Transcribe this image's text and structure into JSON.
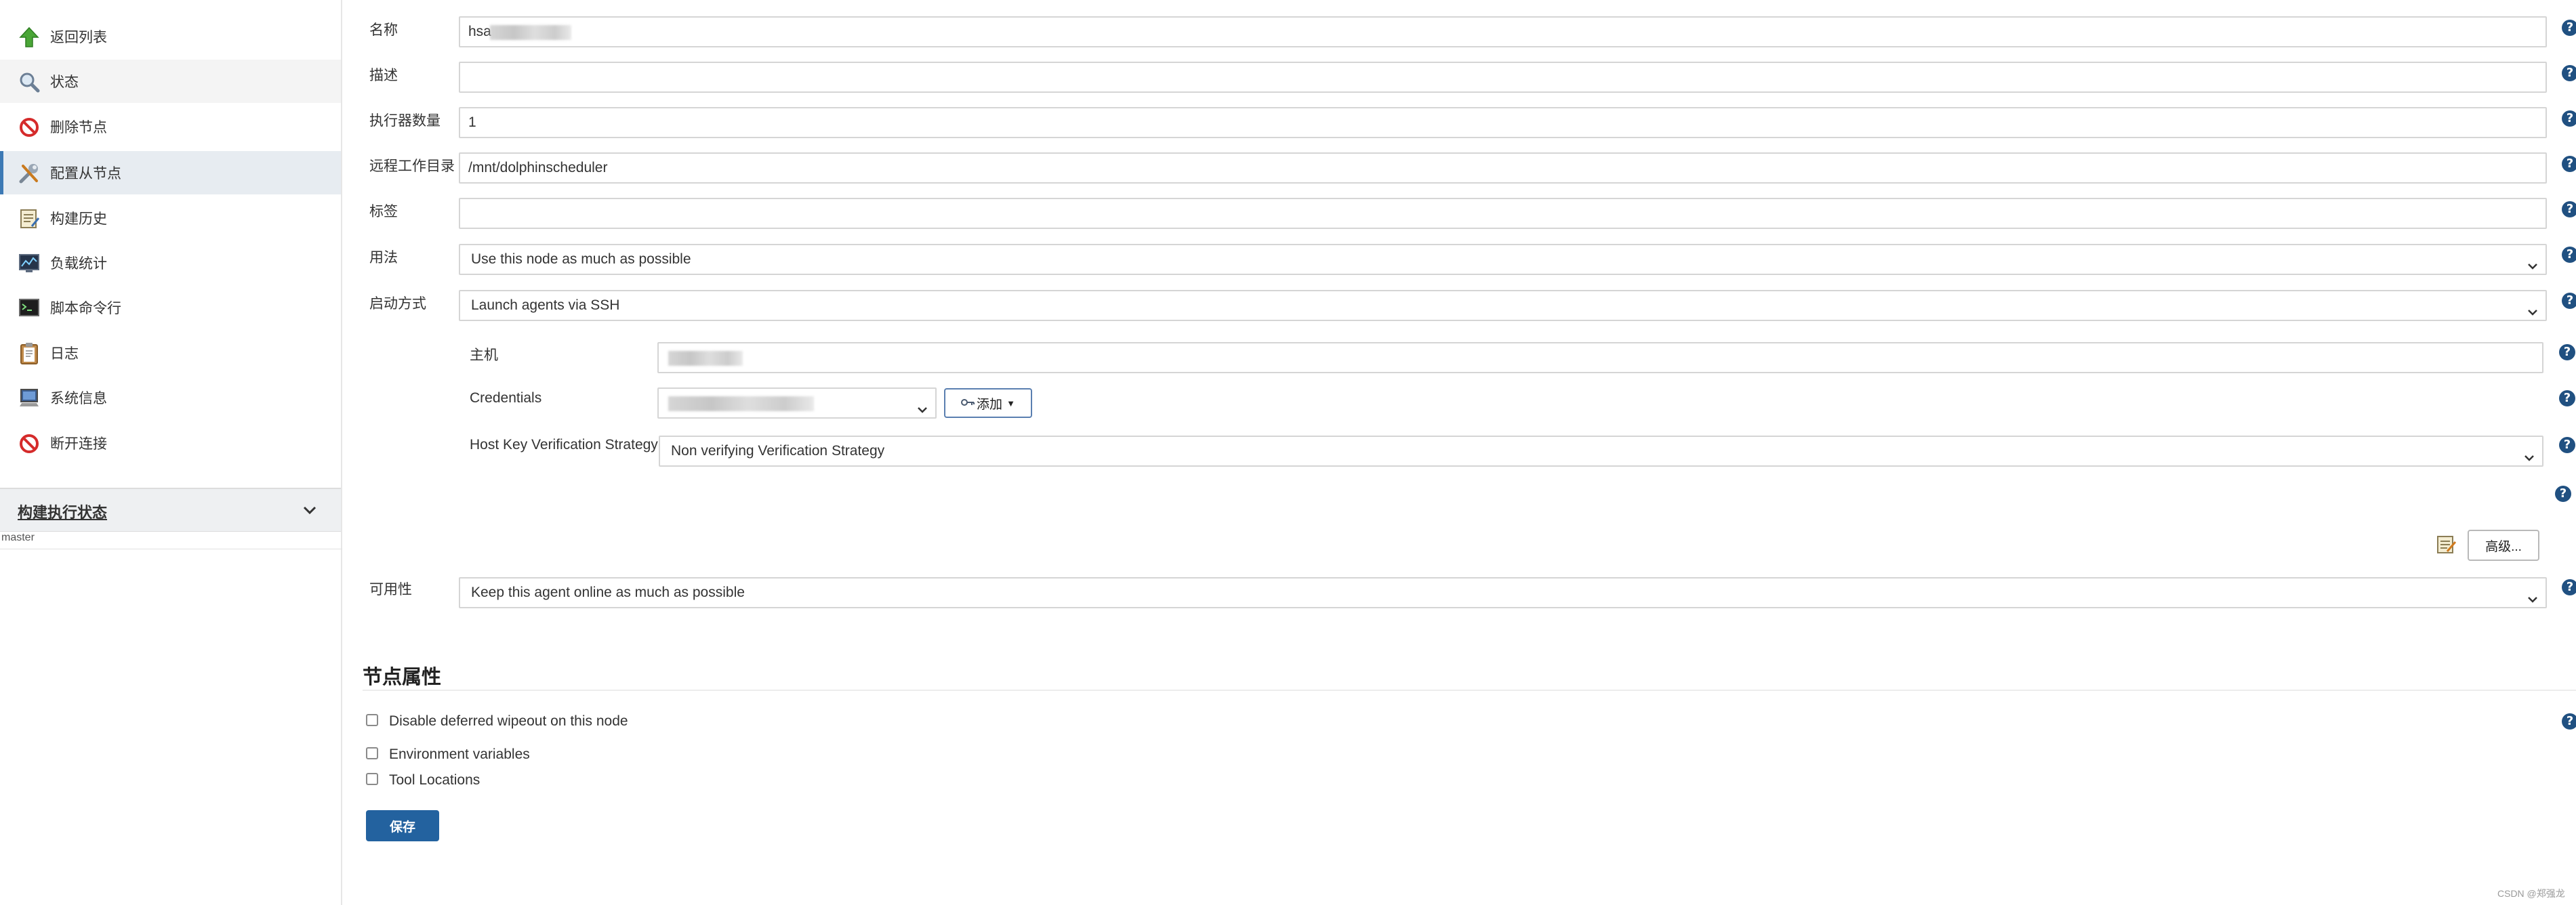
{
  "sidebar": {
    "items": [
      {
        "label": "返回列表",
        "icon": "up-arrow-icon"
      },
      {
        "label": "状态",
        "icon": "magnifier-icon"
      },
      {
        "label": "删除节点",
        "icon": "no-entry-icon"
      },
      {
        "label": "配置从节点",
        "icon": "tools-icon"
      },
      {
        "label": "构建历史",
        "icon": "notepad-icon"
      },
      {
        "label": "负载统计",
        "icon": "monitor-chart-icon"
      },
      {
        "label": "脚本命令行",
        "icon": "terminal-icon"
      },
      {
        "label": "日志",
        "icon": "clipboard-icon"
      },
      {
        "label": "系统信息",
        "icon": "computer-icon"
      },
      {
        "label": "断开连接",
        "icon": "no-entry-icon"
      }
    ],
    "executor_status": {
      "title": "构建执行状态",
      "node": "master"
    }
  },
  "form": {
    "name": {
      "label": "名称",
      "value": "hsa"
    },
    "description": {
      "label": "描述",
      "value": ""
    },
    "executors": {
      "label": "执行器数量",
      "value": "1"
    },
    "remote_dir": {
      "label": "远程工作目录",
      "value": "/mnt/dolphinscheduler"
    },
    "labels": {
      "label": "标签",
      "value": ""
    },
    "usage": {
      "label": "用法",
      "value": "Use this node as much as possible"
    },
    "launch": {
      "label": "启动方式",
      "value": "Launch agents via SSH"
    },
    "host": {
      "label": "主机",
      "value": ""
    },
    "credentials": {
      "label": "Credentials",
      "value": "",
      "add_button": "添加"
    },
    "host_key": {
      "label": "Host Key Verification Strategy",
      "value": "Non verifying Verification Strategy"
    },
    "advanced_button": "高级...",
    "availability": {
      "label": "可用性",
      "value": "Keep this agent online as much as possible"
    }
  },
  "node_properties": {
    "title": "节点属性",
    "options": [
      {
        "label": "Disable deferred wipeout on this node",
        "checked": false
      },
      {
        "label": "Environment variables",
        "checked": false
      },
      {
        "label": "Tool Locations",
        "checked": false
      }
    ]
  },
  "save_button": "保存",
  "watermark": "CSDN @郑强龙",
  "colors": {
    "help": "#205081",
    "save": "#23629f",
    "active_sidebar": "#e7ecf1"
  }
}
